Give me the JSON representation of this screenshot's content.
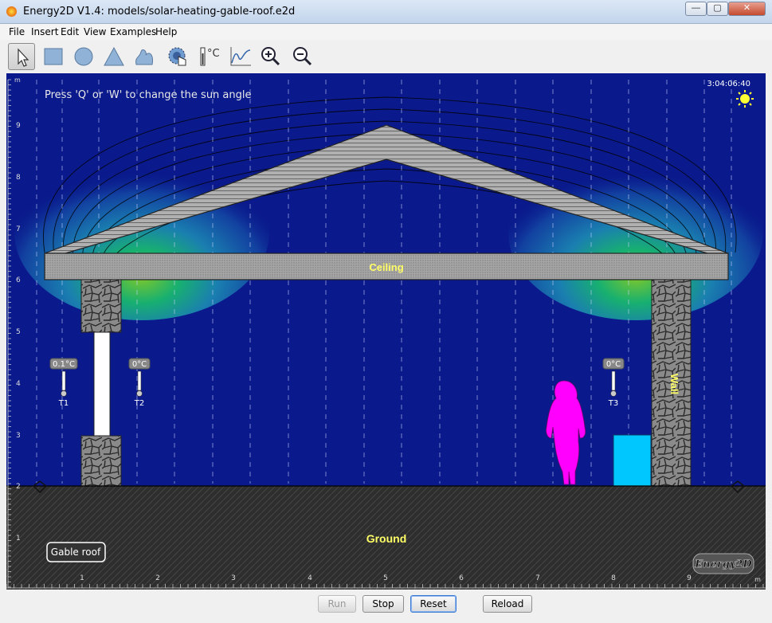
{
  "window": {
    "title": "Energy2D V1.4: models/solar-heating-gable-roof.e2d",
    "controls": {
      "minimize": "—",
      "maximize": "▢",
      "close": "✕"
    }
  },
  "menu": [
    "File",
    "Insert",
    "Edit",
    "View",
    "Examples",
    "Help"
  ],
  "toolbar": {
    "tools": [
      "select-arrow-icon",
      "rectangle-icon",
      "ellipse-icon",
      "triangle-icon",
      "blob-icon",
      "heater-hand-icon",
      "thermometer-icon",
      "graph-icon",
      "zoom-in-icon",
      "zoom-out-icon"
    ],
    "thermometer_unit": "°C"
  },
  "scene": {
    "instruction": "Press 'Q' or 'W' to change the sun angle",
    "clock": "3:04:06:40",
    "ceiling_label": "Ceiling",
    "wall_label": "Wall",
    "ground_label": "Ground",
    "model_label": "Gable roof",
    "logo": "Energy2D",
    "thermometers": [
      {
        "name": "T1",
        "reading": "0.1°C"
      },
      {
        "name": "T2",
        "reading": "0°C"
      },
      {
        "name": "T3",
        "reading": "0°C"
      }
    ],
    "y_axis_unit": "m",
    "y_ticks": [
      "9",
      "8",
      "7",
      "6",
      "5",
      "4",
      "3",
      "2",
      "1"
    ],
    "x_axis_unit": "m",
    "x_ticks": [
      "1",
      "2",
      "3",
      "4",
      "5",
      "6",
      "7",
      "8",
      "9"
    ],
    "colors": {
      "background": "#0a1a8c",
      "ground": "#2e2e2e",
      "person": "#ff00ff",
      "box": "#00c8ff",
      "label": "#ffff66"
    }
  },
  "controls": {
    "run": "Run",
    "stop": "Stop",
    "reset": "Reset",
    "reload": "Reload"
  }
}
